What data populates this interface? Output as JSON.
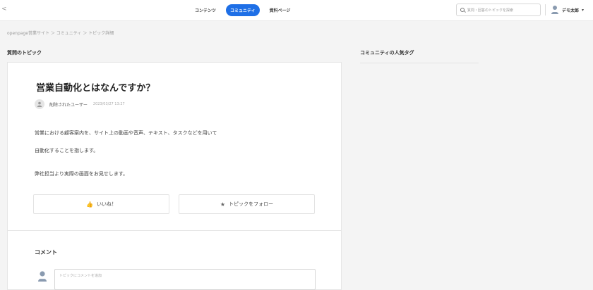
{
  "header": {
    "back_glyph": "<",
    "nav": [
      {
        "label": "コンテンツ",
        "active": false
      },
      {
        "label": "コミュニティ",
        "active": true
      },
      {
        "label": "資料ページ",
        "active": false
      }
    ],
    "search_placeholder": "質問・回答のトピックを探索",
    "user_name": "デモ太郎",
    "caret": "▾"
  },
  "breadcrumb": "openpage営業サイト ＞ コミュニティ ＞ トピック詳細",
  "left_section_title": "質問のトピック",
  "right_section_title": "コミュニティの人気タグ",
  "topic": {
    "title": "営業自動化とはなんですか？",
    "author": "削除されたユーザー",
    "date": "2023/03/27 13:27",
    "body_line1": "営業における顧客案内を、サイト上の動画や音声、テキスト、タスクなどを用いて",
    "body_line2": "自動化することを指します。",
    "body_line3": "弊社担当より実際の画面をお見せします。",
    "like_label": "いいね！",
    "follow_label": "トピックをフォロー"
  },
  "comments": {
    "title": "コメント",
    "input_placeholder": "トピックにコメントを追加"
  },
  "colors": {
    "accent": "#1e6fe6",
    "background": "#f4f4f4"
  },
  "icons": [
    "back-chevron-icon",
    "search-icon",
    "user-avatar-icon",
    "thumbs-up-icon",
    "star-icon"
  ]
}
